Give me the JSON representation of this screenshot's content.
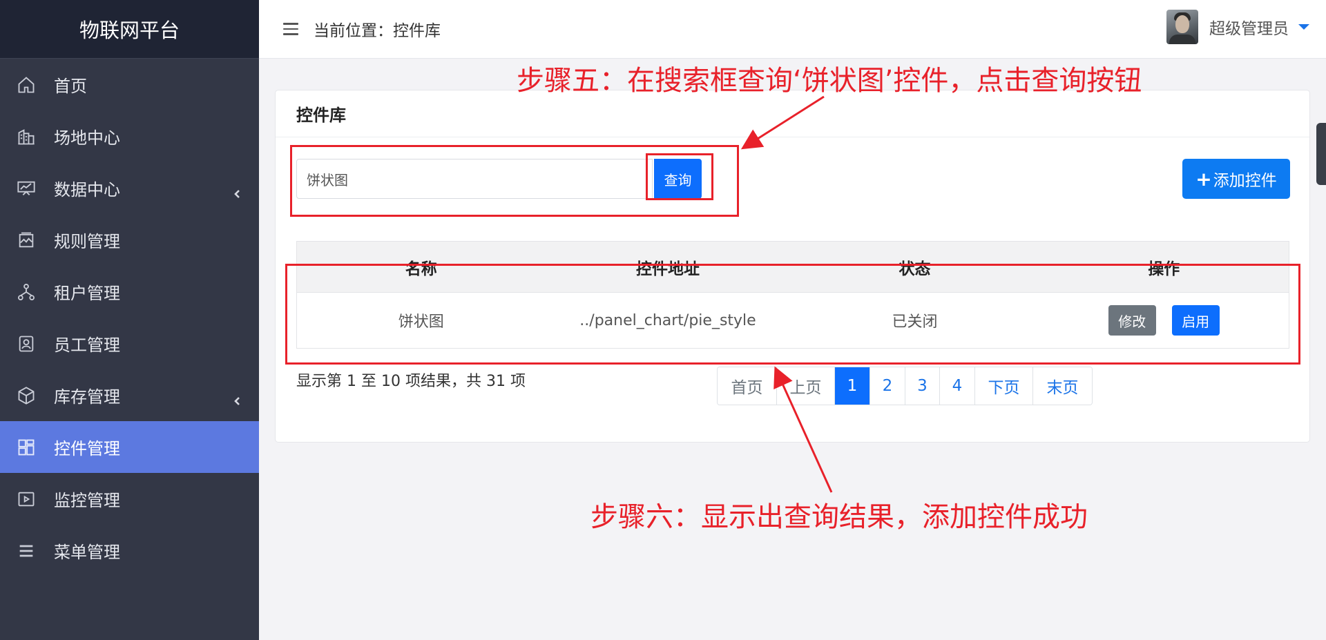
{
  "brand": "物联网平台",
  "sidebar": {
    "items": [
      {
        "label": "首页",
        "icon": "home-icon"
      },
      {
        "label": "场地中心",
        "icon": "building-icon"
      },
      {
        "label": "数据中心",
        "icon": "chart-board-icon",
        "expandable": true
      },
      {
        "label": "规则管理",
        "icon": "rules-icon"
      },
      {
        "label": "租户管理",
        "icon": "org-tree-icon"
      },
      {
        "label": "员工管理",
        "icon": "id-card-icon"
      },
      {
        "label": "库存管理",
        "icon": "box-icon",
        "expandable": true
      },
      {
        "label": "控件管理",
        "icon": "widgets-icon",
        "active": true
      },
      {
        "label": "监控管理",
        "icon": "video-icon"
      },
      {
        "label": "菜单管理",
        "icon": "menu-list-icon"
      }
    ]
  },
  "topbar": {
    "breadcrumb": "当前位置：控件库",
    "user_name": "超级管理员"
  },
  "card": {
    "title": "控件库",
    "search": {
      "value": "饼状图",
      "button": "查询"
    },
    "add_button": "添加控件",
    "table": {
      "headers": [
        "名称",
        "控件地址",
        "状态",
        "操作"
      ],
      "rows": [
        {
          "name": "饼状图",
          "address": "../panel_chart/pie_style",
          "status": "已关闭",
          "edit": "修改",
          "enable": "启用"
        }
      ]
    },
    "summary": "显示第 1 至 10 项结果，共 31 项",
    "pagination": {
      "first": "首页",
      "prev": "上页",
      "pages": [
        "1",
        "2",
        "3",
        "4"
      ],
      "current": "1",
      "next": "下页",
      "last": "末页"
    }
  },
  "annotations": {
    "step5": "步骤五：在搜索框查询‘饼状图’控件，点击查询按钮",
    "step6": "步骤六：显示出查询结果，添加控件成功",
    "color": "#e8212a"
  },
  "colors": {
    "sidebar_bg": "#333746",
    "brand_bg": "#1f2434",
    "active_item": "#5c79e0",
    "primary": "#0d6efd"
  }
}
